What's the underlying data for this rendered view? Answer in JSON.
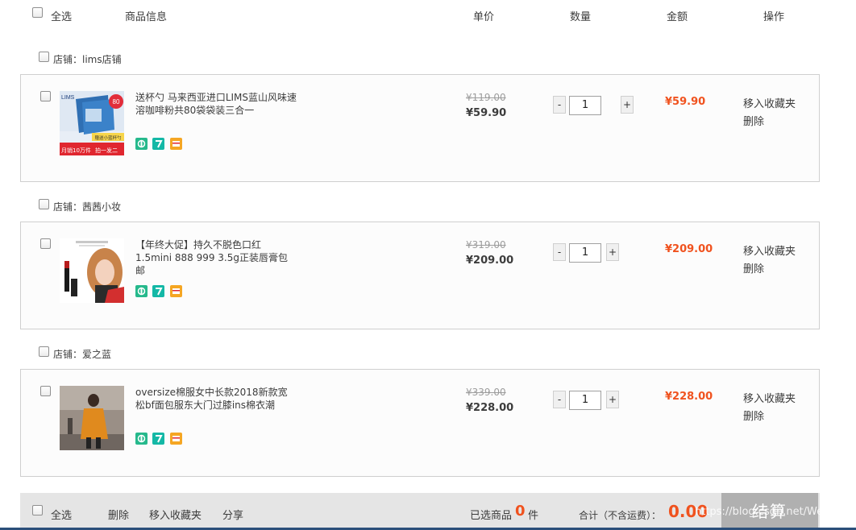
{
  "header": {
    "select_all": "全选",
    "product_info": "商品信息",
    "unit_price": "单价",
    "quantity": "数量",
    "amount": "金额",
    "operations": "操作"
  },
  "shops": [
    {
      "label": "店铺：lims店铺",
      "item": {
        "title": "送杯勺 马来西亚进口LIMS蓝山风味速溶咖啡粉共80袋袋装三合一",
        "thumb_text_top": "LIMS",
        "thumb_badge": "80",
        "thumb_text_mid": "赠送小蓝杯勺",
        "thumb_text_bottom": "月销10万件",
        "thumb_text_right": "拍一发二",
        "old_price": "¥119.00",
        "price": "¥59.90",
        "qty": "1",
        "amount": "¥59.90",
        "op_fav": "移入收藏夹",
        "op_del": "删除"
      }
    },
    {
      "label": "店铺：茜茜小妆",
      "item": {
        "title": "【年终大促】持久不脱色口红1.5mini 888 999 3.5g正装唇膏包邮",
        "old_price": "¥319.00",
        "price": "¥209.00",
        "qty": "1",
        "amount": "¥209.00",
        "op_fav": "移入收藏夹",
        "op_del": "删除"
      }
    },
    {
      "label": "店铺：爱之蓝",
      "item": {
        "title": "oversize棉服女中长款2018新款宽松bf面包服东大门过膝ins棉衣潮",
        "old_price": "¥339.00",
        "price": "¥228.00",
        "qty": "1",
        "amount": "¥228.00",
        "op_fav": "移入收藏夹",
        "op_del": "删除"
      }
    }
  ],
  "qty_controls": {
    "minus": "-",
    "plus": "+"
  },
  "footer": {
    "select_all": "全选",
    "delete": "删除",
    "move_fav": "移入收藏夹",
    "share": "分享",
    "selected_label": "已选商品",
    "selected_count": "0",
    "selected_unit": "件",
    "total_label": "合计（不含运费）：",
    "total_value": "0.00",
    "checkout": "结算"
  },
  "watermark": "https://blog.csdn.net/We_jia",
  "colors": {
    "accent": "#f0521e",
    "footer_bg": "#e5e5e5",
    "checkout_bg": "#b0b0b0",
    "badge_green": "#3cb371",
    "badge_teal": "#1abc9c",
    "badge_orange": "#f5a623"
  }
}
